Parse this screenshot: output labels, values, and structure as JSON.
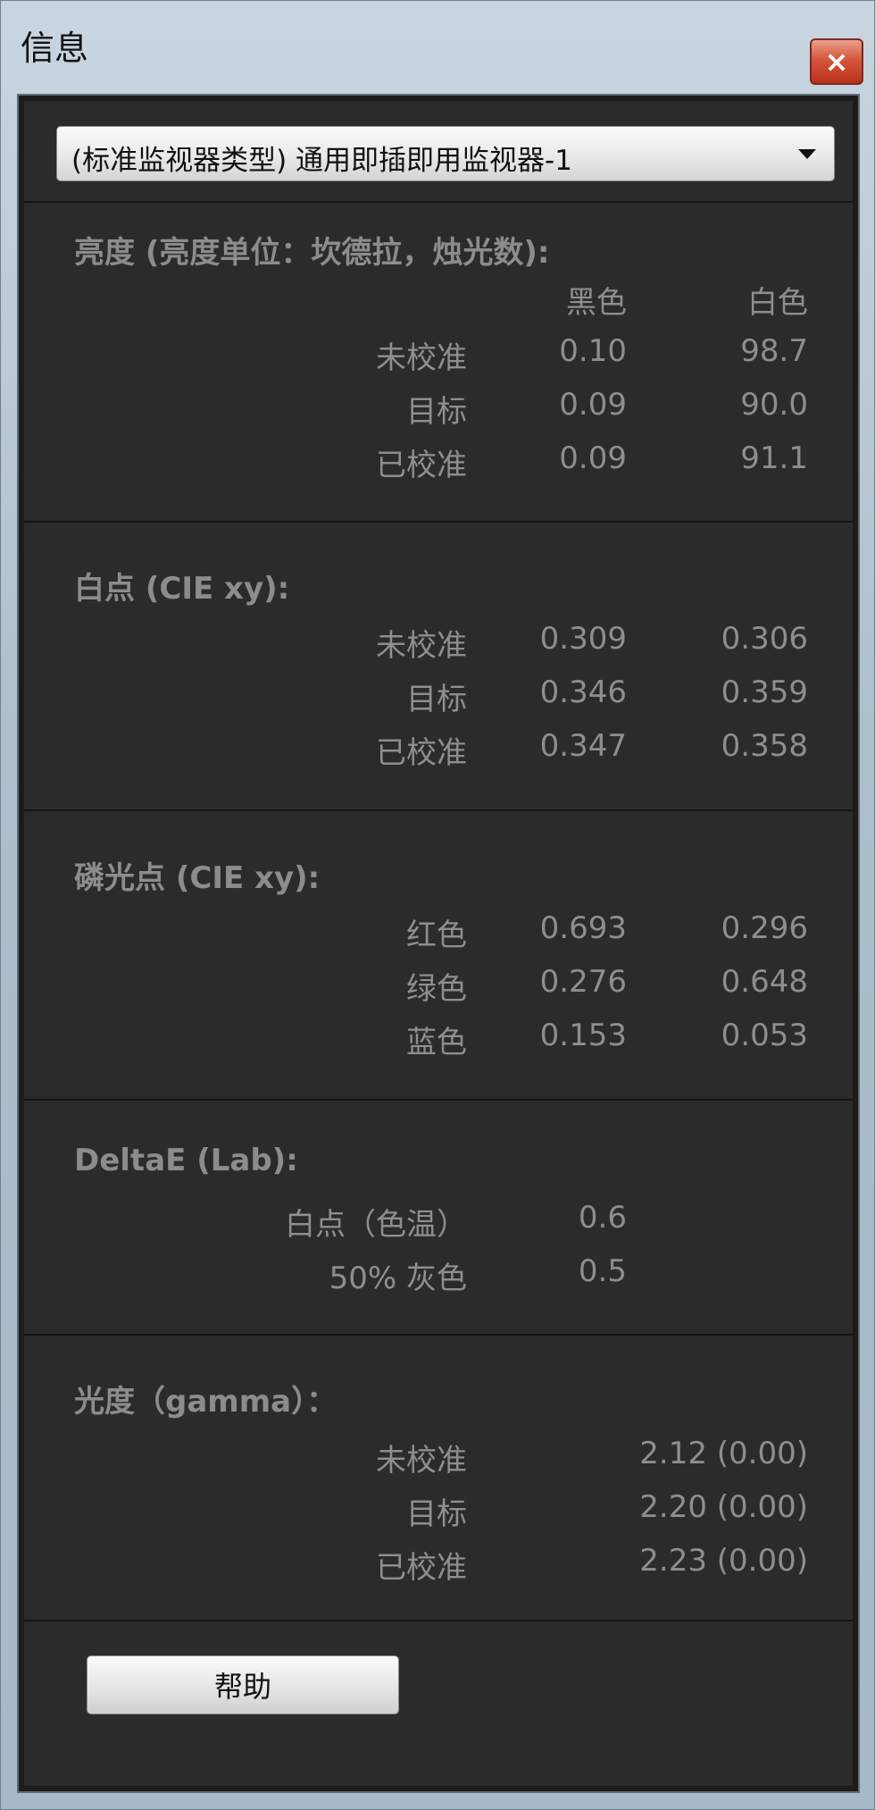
{
  "window": {
    "title": "信息",
    "close_label": "×"
  },
  "monitor_select": {
    "value": "(标准监视器类型) 通用即插即用监视器-1"
  },
  "luminance": {
    "title": "亮度 (亮度单位：坎德拉，烛光数):",
    "col_black": "黑色",
    "col_white": "白色",
    "rows": [
      {
        "label": "未校准",
        "black": "0.10",
        "white": "98.7"
      },
      {
        "label": "目标",
        "black": "0.09",
        "white": "90.0"
      },
      {
        "label": "已校准",
        "black": "0.09",
        "white": "91.1"
      }
    ]
  },
  "whitepoint": {
    "title": "白点 (CIE xy):",
    "rows": [
      {
        "label": "未校准",
        "x": "0.309",
        "y": "0.306"
      },
      {
        "label": "目标",
        "x": "0.346",
        "y": "0.359"
      },
      {
        "label": "已校准",
        "x": "0.347",
        "y": "0.358"
      }
    ]
  },
  "phosphors": {
    "title": "磷光点 (CIE xy):",
    "rows": [
      {
        "label": "红色",
        "x": "0.693",
        "y": "0.296"
      },
      {
        "label": "绿色",
        "x": "0.276",
        "y": "0.648"
      },
      {
        "label": "蓝色",
        "x": "0.153",
        "y": "0.053"
      }
    ]
  },
  "deltae": {
    "title": "DeltaE (Lab):",
    "rows": [
      {
        "label": "白点（色温）",
        "value": "0.6"
      },
      {
        "label": "50% 灰色",
        "value": "0.5"
      }
    ]
  },
  "gamma": {
    "title": "光度（gamma）：",
    "rows": [
      {
        "label": "未校准",
        "value": "2.12 (0.00)"
      },
      {
        "label": "目标",
        "value": "2.20 (0.00)"
      },
      {
        "label": "已校准",
        "value": "2.23 (0.00)"
      }
    ]
  },
  "help_button": {
    "label": "帮助"
  }
}
